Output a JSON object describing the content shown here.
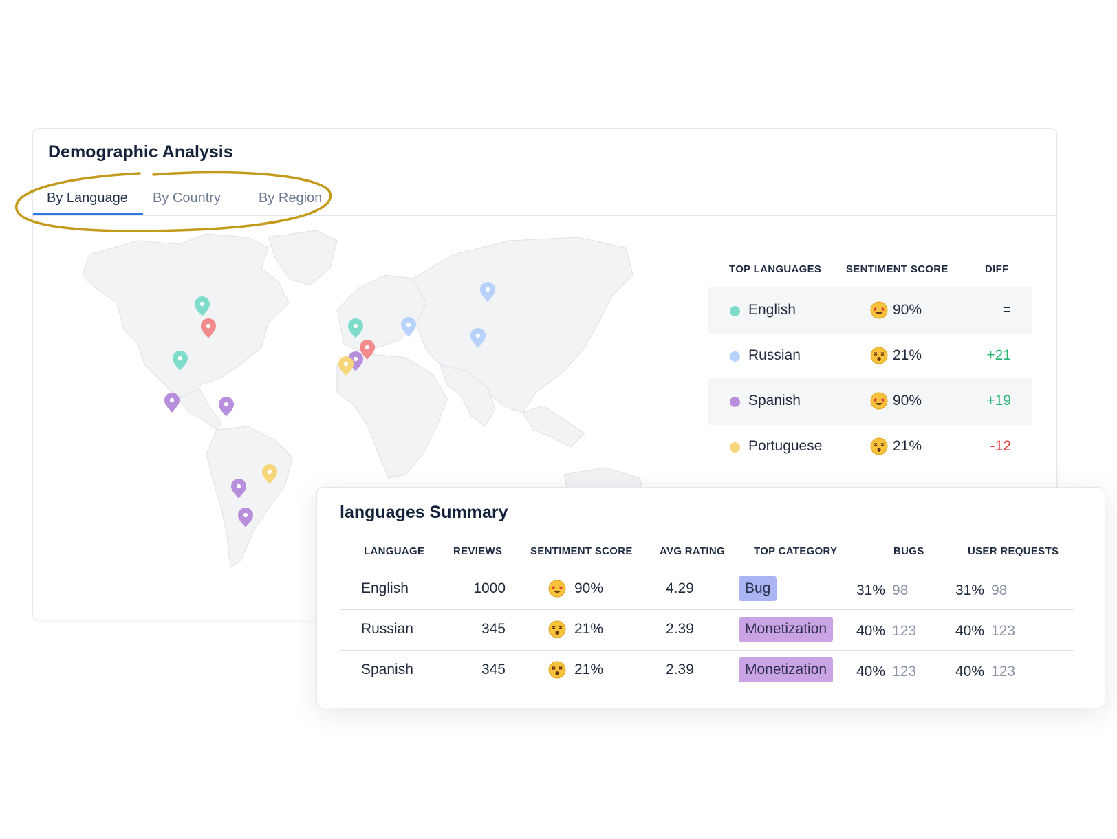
{
  "demographic": {
    "title": "Demographic Analysis",
    "tabs": [
      "By Language",
      "By Country",
      "By Region"
    ],
    "active_tab": "By Language"
  },
  "top_languages": {
    "headers": [
      "TOP LANGUAGES",
      "SENTIMENT SCORE",
      "DIFF"
    ],
    "rows": [
      {
        "language": "English",
        "color": "#7fdccb",
        "emoji": "star-struck-emoji",
        "score": "90%",
        "diff": "=",
        "diff_color": "#1f2a3d"
      },
      {
        "language": "Russian",
        "color": "#b7d2fb",
        "emoji": "dizzy-face-emoji",
        "score": "21%",
        "diff": "+21",
        "diff_color": "#2bb673"
      },
      {
        "language": "Spanish",
        "color": "#b88fdc",
        "emoji": "star-struck-emoji",
        "score": "90%",
        "diff": "+19",
        "diff_color": "#2bb673"
      },
      {
        "language": "Portuguese",
        "color": "#f6d67a",
        "emoji": "dizzy-face-emoji",
        "score": "21%",
        "diff": "-12",
        "diff_color": "#e5383b"
      }
    ]
  },
  "summary": {
    "title": "languages Summary",
    "headers": [
      "LANGUAGE",
      "REVIEWS",
      "SENTIMENT SCORE",
      "AVG RATING",
      "TOP CATEGORY",
      "BUGS",
      "USER REQUESTS"
    ],
    "rows": [
      {
        "language": "English",
        "reviews": "1000",
        "emoji": "star-struck-emoji",
        "score": "90%",
        "rating": "4.29",
        "category": "Bug",
        "category_color": "#aab6f4",
        "bugs_pct": "31%",
        "bugs_n": "98",
        "req_pct": "31%",
        "req_n": "98"
      },
      {
        "language": "Russian",
        "reviews": "345",
        "emoji": "dizzy-face-emoji",
        "score": "21%",
        "rating": "2.39",
        "category": "Monetization",
        "category_color": "#c9a3e3",
        "bugs_pct": "40%",
        "bugs_n": "123",
        "req_pct": "40%",
        "req_n": "123"
      },
      {
        "language": "Spanish",
        "reviews": "345",
        "emoji": "dizzy-face-emoji",
        "score": "21%",
        "rating": "2.39",
        "category": "Monetization",
        "category_color": "#c9a3e3",
        "bugs_pct": "40%",
        "bugs_n": "123",
        "req_pct": "40%",
        "req_n": "123"
      }
    ]
  },
  "map_pins": [
    {
      "language": "English",
      "color": "#7fdccb"
    },
    {
      "language": "English",
      "color": "#7fdccb"
    },
    {
      "language": "English",
      "color": "#7fdccb"
    },
    {
      "language": "Russian",
      "color": "#b7d2fb"
    },
    {
      "language": "Russian",
      "color": "#b7d2fb"
    },
    {
      "language": "Russian",
      "color": "#b7d2fb"
    },
    {
      "language": "Spanish",
      "color": "#b88fdc"
    },
    {
      "language": "Spanish",
      "color": "#b88fdc"
    },
    {
      "language": "Spanish",
      "color": "#b88fdc"
    },
    {
      "language": "Spanish",
      "color": "#b88fdc"
    },
    {
      "language": "Spanish",
      "color": "#b88fdc"
    },
    {
      "language": "Portuguese",
      "color": "#f6d67a"
    },
    {
      "language": "Portuguese",
      "color": "#f6d67a"
    },
    {
      "language": "Other",
      "color": "#f28b8b"
    },
    {
      "language": "Other",
      "color": "#f28b8b"
    }
  ],
  "highlight_color": "#c49a1c"
}
